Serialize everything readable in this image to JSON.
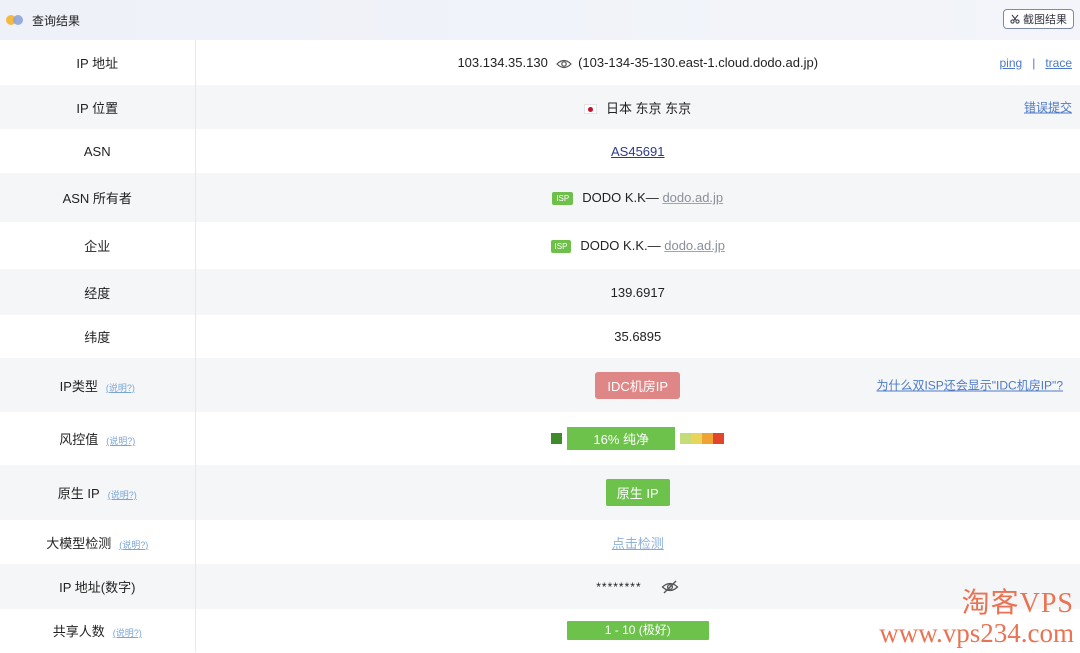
{
  "header": {
    "title": "查询结果",
    "screenshot_button": "截图结果",
    "scissors_icon": "scissors-icon"
  },
  "rows": {
    "ip_address": {
      "label": "IP 地址",
      "ip": "103.134.35.130",
      "hostname": "(103-134-35-130.east-1.cloud.dodo.ad.jp)",
      "ping": "ping",
      "separator": "|",
      "trace": "trace"
    },
    "ip_location": {
      "label": "IP 位置",
      "location": "日本 东京 东京",
      "report_error": "错误提交",
      "flag": "japan-flag"
    },
    "asn": {
      "label": "ASN",
      "value": "AS45691"
    },
    "asn_owner": {
      "label": "ASN 所有者",
      "tag": "ISP",
      "name": "DODO K.K—",
      "domain": "dodo.ad.jp"
    },
    "company": {
      "label": "企业",
      "tag": "ISP",
      "name": "DODO K.K.—",
      "domain": "dodo.ad.jp"
    },
    "longitude": {
      "label": "经度",
      "value": "139.6917"
    },
    "latitude": {
      "label": "纬度",
      "value": "35.6895"
    },
    "ip_type": {
      "label": "IP类型",
      "hint": "(说明?)",
      "badge": "IDC机房IP",
      "question_link": "为什么双ISP还会显示\"IDC机房IP\"?"
    },
    "risk": {
      "label": "风控值",
      "hint": "(说明?)",
      "value_text": "16%  纯净",
      "value_percent": 16,
      "colors": {
        "dot": "#3f8a2b",
        "bar": "#6cc24a",
        "scale": [
          "#c5dc7a",
          "#e8d55a",
          "#f0a335",
          "#e2452a"
        ]
      }
    },
    "native_ip": {
      "label": "原生 IP",
      "hint": "(说明?)",
      "badge": "原生 IP"
    },
    "llm_check": {
      "label": "大模型检测",
      "hint": "(说明?)",
      "link": "点击检测"
    },
    "ip_numeric": {
      "label": "IP 地址(数字)",
      "masked": "********",
      "eye_icon": "eye-off-icon"
    },
    "shared_users": {
      "label": "共享人数",
      "hint": "(说明?)",
      "value": "1 - 10 (极好)"
    }
  },
  "watermark": {
    "line1": "淘客VPS",
    "line2": "www.vps234.com"
  },
  "colors": {
    "accent_green": "#6cc24a",
    "badge_red": "#df8787",
    "link_blue": "#4d79c7",
    "watermark": "#e8603c"
  }
}
